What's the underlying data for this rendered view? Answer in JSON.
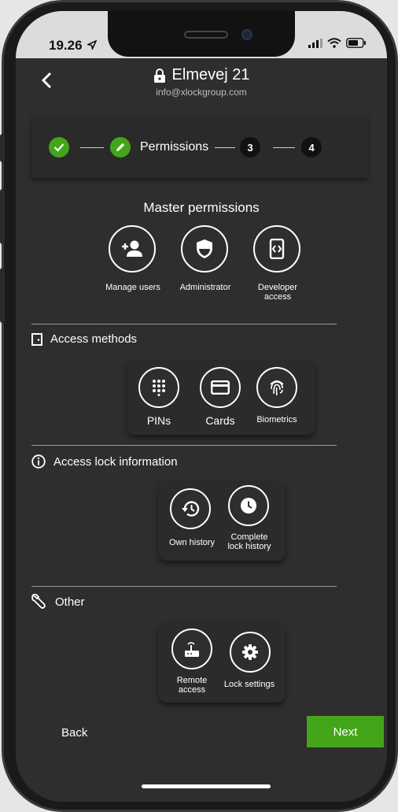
{
  "status": {
    "time": "19.26"
  },
  "header": {
    "title": "Elmevej 21",
    "subtitle": "info@xlockgroup.com"
  },
  "stepper": {
    "current_label": "Permissions",
    "step3": "3",
    "step4": "4"
  },
  "master": {
    "title": "Master permissions",
    "items": [
      {
        "label": "Manage users",
        "icon": "add-user-icon"
      },
      {
        "label": "Administrator",
        "icon": "shield-icon"
      },
      {
        "label": "Developer access",
        "icon": "developer-icon"
      }
    ]
  },
  "access_methods": {
    "title": "Access methods",
    "items": [
      {
        "label": "PINs",
        "icon": "keypad-icon"
      },
      {
        "label": "Cards",
        "icon": "card-icon"
      },
      {
        "label": "Biometrics",
        "icon": "fingerprint-icon"
      }
    ]
  },
  "lock_info": {
    "title": "Access lock information",
    "items": [
      {
        "label": "Own history",
        "icon": "history-icon"
      },
      {
        "label": "Complete lock history",
        "icon": "clock-icon"
      }
    ]
  },
  "other": {
    "title": "Other",
    "items": [
      {
        "label": "Remote access",
        "icon": "router-icon"
      },
      {
        "label": "Lock settings",
        "icon": "gear-icon"
      }
    ]
  },
  "footer": {
    "back": "Back",
    "next": "Next"
  },
  "colors": {
    "accent": "#43a519",
    "background": "#2e2e2e"
  }
}
